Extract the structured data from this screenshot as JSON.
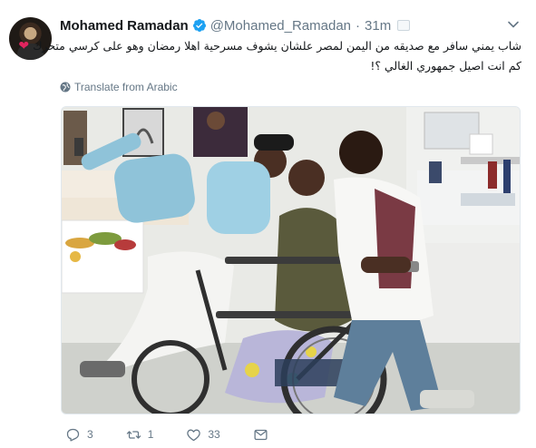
{
  "user": {
    "name": "Mohamed Ramadan",
    "handle": "@Mohamed_Ramadan",
    "separator": "·",
    "time": "31m"
  },
  "tweet": {
    "line1": "شاب يمني سافر مع صديقه من اليمن لمصر علشان يشوف مسرحية اهلا رمضان وهو على كرسي متحرك",
    "line2": "كم انت اصيل جمهوري الغالي ؟!",
    "emoji": "❤"
  },
  "translate_label": "Translate from Arabic",
  "actions": {
    "reply_count": "3",
    "retweet_count": "1",
    "like_count": "33"
  },
  "icons": {
    "verified": "verified-badge-icon",
    "chevron": "chevron-down-icon",
    "globe": "globe-icon",
    "reply": "reply-icon",
    "retweet": "retweet-icon",
    "like": "heart-icon",
    "dm": "direct-message-icon"
  },
  "colors": {
    "verified": "#1da1f2",
    "muted": "#657786",
    "heart": "#e0245e"
  }
}
